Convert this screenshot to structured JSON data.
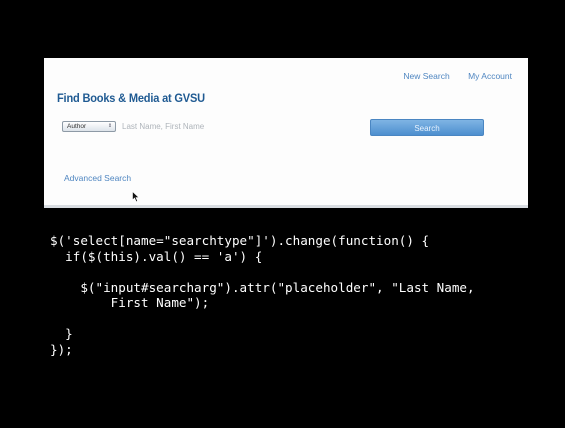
{
  "panel": {
    "title": "Find Books & Media at GVSU",
    "links": {
      "new_search": "New Search",
      "my_account": "My Account"
    },
    "search": {
      "type_selected": "Author",
      "placeholder": "Last Name, First Name",
      "button_label": "Search"
    },
    "advanced_search": "Advanced Search"
  },
  "code": {
    "lines": [
      "$('select[name=\"searchtype\"]').change(function() {",
      "  if($(this).val() == 'a') {",
      "",
      "    $(\"input#searcharg\").attr(\"placeholder\", \"Last Name,",
      "        First Name\");",
      "",
      "  }",
      "});"
    ]
  },
  "colors": {
    "background": "#000000",
    "panel": "#fdfdfd",
    "title": "#1f5a92",
    "link": "#4f86c1",
    "button": "#5f9fd9"
  }
}
